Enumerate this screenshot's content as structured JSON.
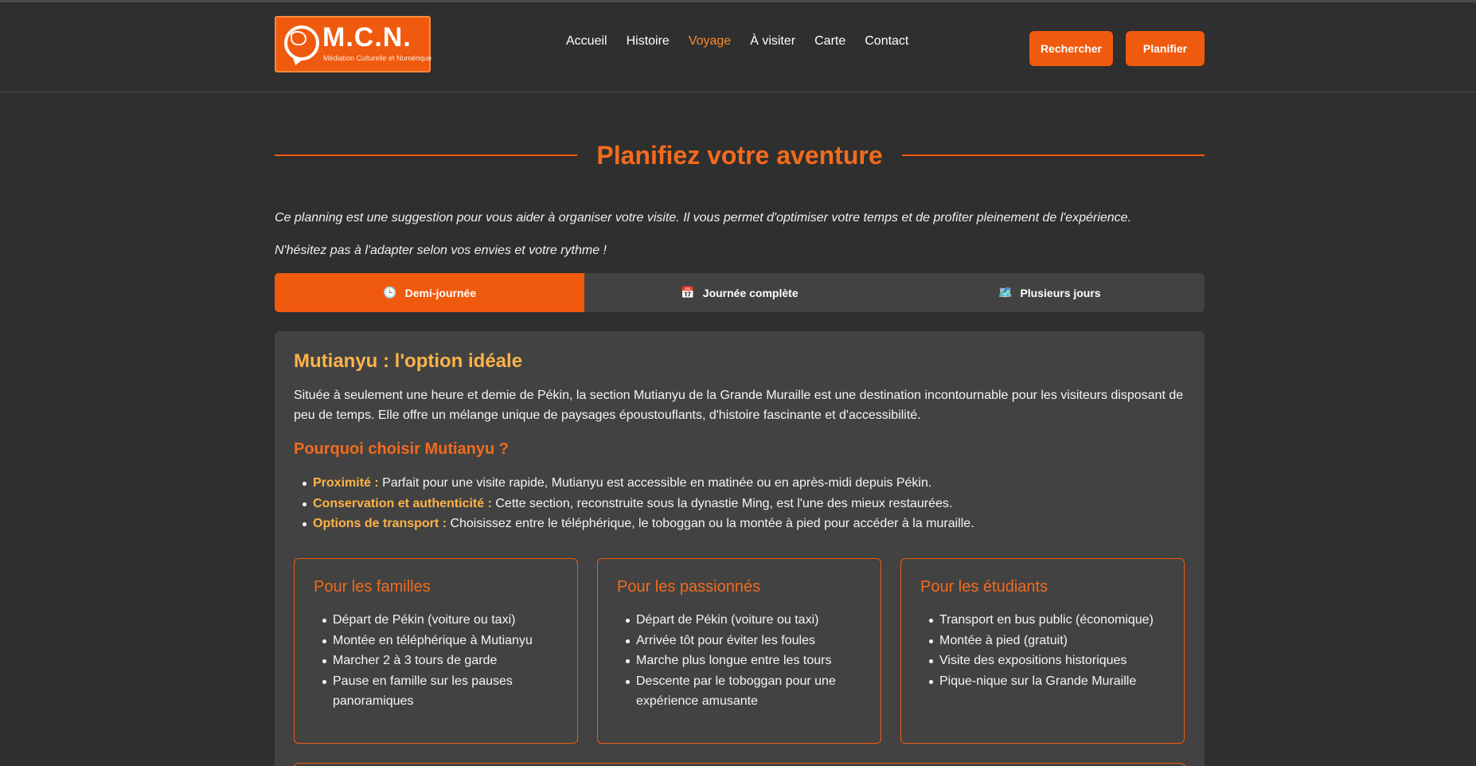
{
  "header": {
    "logo_title": "M.C.N.",
    "logo_subtitle": "Médiation Culturelle et Numérique",
    "nav": [
      {
        "label": "Accueil",
        "active": false
      },
      {
        "label": "Histoire",
        "active": false
      },
      {
        "label": "Voyage",
        "active": true
      },
      {
        "label": "À visiter",
        "active": false
      },
      {
        "label": "Carte",
        "active": false
      },
      {
        "label": "Contact",
        "active": false
      }
    ],
    "search_label": "Rechercher",
    "plan_label": "Planifier"
  },
  "main": {
    "title": "Planifiez votre aventure",
    "intro_1": "Ce planning est une suggestion pour vous aider à organiser votre visite. Il vous permet d'optimiser votre temps et de profiter pleinement de l'expérience.",
    "intro_2": "N'hésitez pas à l'adapter selon vos envies et votre rythme !",
    "tabs": [
      {
        "icon": "clock-icon",
        "glyph": "🕒",
        "label": "Demi-journée",
        "active": true
      },
      {
        "icon": "calendar-icon",
        "glyph": "📅",
        "label": "Journée complète",
        "active": false
      },
      {
        "icon": "map-icon",
        "glyph": "🗺️",
        "label": "Plusieurs jours",
        "active": false
      }
    ]
  },
  "card": {
    "heading": "Mutianyu : l'option idéale",
    "description": "Située à seulement une heure et demie de Pékin, la section Mutianyu de la Grande Muraille est une destination incontournable pour les visiteurs disposant de peu de temps. Elle offre un mélange unique de paysages époustouflants, d'histoire fascinante et d'accessibilité.",
    "why_heading": "Pourquoi choisir Mutianyu ?",
    "reasons": [
      {
        "label": "Proximité :",
        "text": " Parfait pour une visite rapide, Mutianyu est accessible en matinée ou en après-midi depuis Pékin."
      },
      {
        "label": "Conservation et authenticité :",
        "text": " Cette section, reconstruite sous la dynastie Ming, est l'une des mieux restaurées."
      },
      {
        "label": "Options de transport :",
        "text": " Choisissez entre le téléphérique, le toboggan ou la montée à pied pour accéder à la muraille."
      }
    ],
    "boxes": [
      {
        "title": "Pour les familles",
        "items": [
          "Départ de Pékin (voiture ou taxi)",
          "Montée en téléphérique à Mutianyu",
          "Marcher 2 à 3 tours de garde",
          "Pause en famille sur les pauses panoramiques"
        ]
      },
      {
        "title": "Pour les passionnés",
        "items": [
          "Départ de Pékin (voiture ou taxi)",
          "Arrivée tôt pour éviter les foules",
          "Marche plus longue entre les tours",
          "Descente par le toboggan pour une expérience amusante"
        ]
      },
      {
        "title": "Pour les étudiants",
        "items": [
          "Transport en bus public (économique)",
          "Montée à pied (gratuit)",
          "Visite des expositions historiques",
          "Pique-nique sur la Grande Muraille"
        ]
      }
    ]
  },
  "colors": {
    "accent": "#f05a0e",
    "highlight": "#ffb347",
    "background": "#2f2f2f",
    "card": "#424242"
  }
}
